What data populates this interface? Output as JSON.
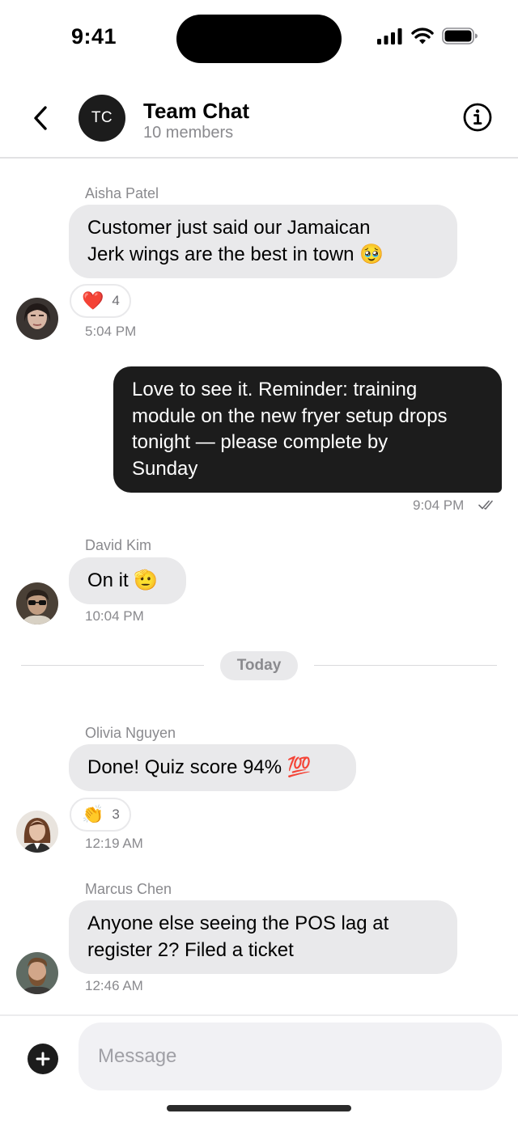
{
  "status_bar": {
    "time": "9:41"
  },
  "header": {
    "avatar_initials": "TC",
    "title": "Team Chat",
    "subtitle": "10 members"
  },
  "messages": [
    {
      "sender": "Aisha Patel",
      "lines": [
        "Customer just said our Jamaican",
        "Jerk wings are the best in town 🥹"
      ],
      "reaction": {
        "emoji": "❤️",
        "count": "4"
      },
      "time": "5:04 PM",
      "direction": "incoming"
    },
    {
      "sender": "",
      "lines": [
        "Love to see it. Reminder: training",
        "module on the new fryer setup drops",
        "tonight — please complete by",
        "Sunday"
      ],
      "time": "9:04 PM",
      "status": "read",
      "direction": "outgoing"
    },
    {
      "sender": "David Kim",
      "lines": [
        "On it 🫡"
      ],
      "time": "10:04 PM",
      "direction": "incoming"
    },
    {
      "sender": "Olivia Nguyen",
      "lines": [
        "Done! Quiz score 94% 💯"
      ],
      "reaction": {
        "emoji": "👏",
        "count": "3"
      },
      "time": "12:19 AM",
      "direction": "incoming"
    },
    {
      "sender": "Marcus Chen",
      "lines": [
        "Anyone else seeing the POS lag at",
        "register 2? Filed a ticket"
      ],
      "time": "12:46 AM",
      "direction": "incoming"
    }
  ],
  "date_divider": "Today",
  "composer": {
    "placeholder": "Message"
  },
  "colors": {
    "incoming_bubble": "#e9e9eb",
    "outgoing_bubble": "#1c1c1c",
    "meta_text": "#8a8a8e"
  }
}
